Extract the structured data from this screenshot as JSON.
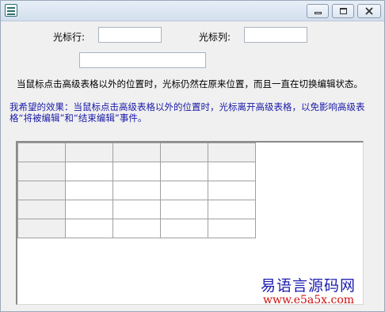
{
  "window": {
    "title": ""
  },
  "fields": {
    "cursor_row_label": "光标行:",
    "cursor_row_value": "",
    "cursor_col_label": "光标列:",
    "cursor_col_value": "",
    "extra_value": ""
  },
  "texts": {
    "description": "当鼠标点击高级表格以外的位置时，光标仍然在原来位置，而且一直在切换编辑状态。",
    "desired_effect": "我希望的效果：当鼠标点击高级表格以外的位置时，光标离开高级表格，以免影响高级表格“将被编辑”和“结束编辑”事件。"
  },
  "table": {
    "rows": 5,
    "cols": 5
  },
  "watermark": {
    "site_name": "易语言源码网",
    "url": "www.e5a5x.com"
  },
  "icons": {
    "minimize": "minimize-icon",
    "maximize": "maximize-icon",
    "close": "close-icon",
    "app": "app-icon"
  }
}
